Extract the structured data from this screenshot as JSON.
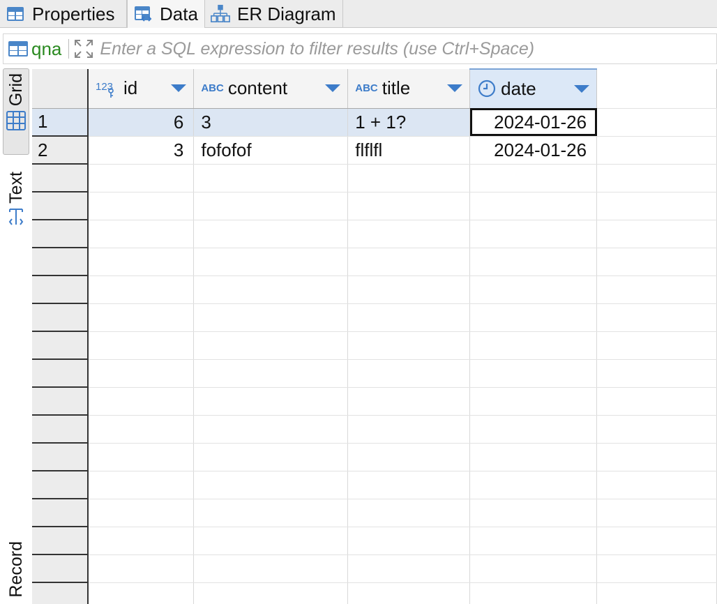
{
  "tabs": [
    {
      "label": "Properties",
      "icon": "table-icon",
      "active": false
    },
    {
      "label": "Data",
      "icon": "table-data-icon",
      "active": true
    },
    {
      "label": "ER Diagram",
      "icon": "er-diagram-icon",
      "active": false
    }
  ],
  "filter": {
    "entity": "qna",
    "placeholder": "Enter a SQL expression to filter results (use Ctrl+Space)",
    "value": ""
  },
  "side_panel": {
    "grid_label": "Grid",
    "text_label": "Text",
    "record_label": "Record"
  },
  "columns": [
    {
      "name": "id",
      "type_badge": "123",
      "icon": "numeric-key-icon"
    },
    {
      "name": "content",
      "type_badge": "ABC",
      "icon": "string-type-icon"
    },
    {
      "name": "title",
      "type_badge": "ABC",
      "icon": "string-type-icon"
    },
    {
      "name": "date",
      "type_badge": "",
      "icon": "clock-icon"
    }
  ],
  "rows": [
    {
      "num": "1",
      "id": "6",
      "content": "3",
      "title": "1 + 1?",
      "date": "2024-01-26"
    },
    {
      "num": "2",
      "id": "3",
      "content": "fofofof",
      "title": "flflfl",
      "date": "2024-01-26"
    }
  ],
  "colors": {
    "accent": "#3d7cc9",
    "entity_green": "#2a8a20",
    "selected_row": "#dce6f3"
  }
}
